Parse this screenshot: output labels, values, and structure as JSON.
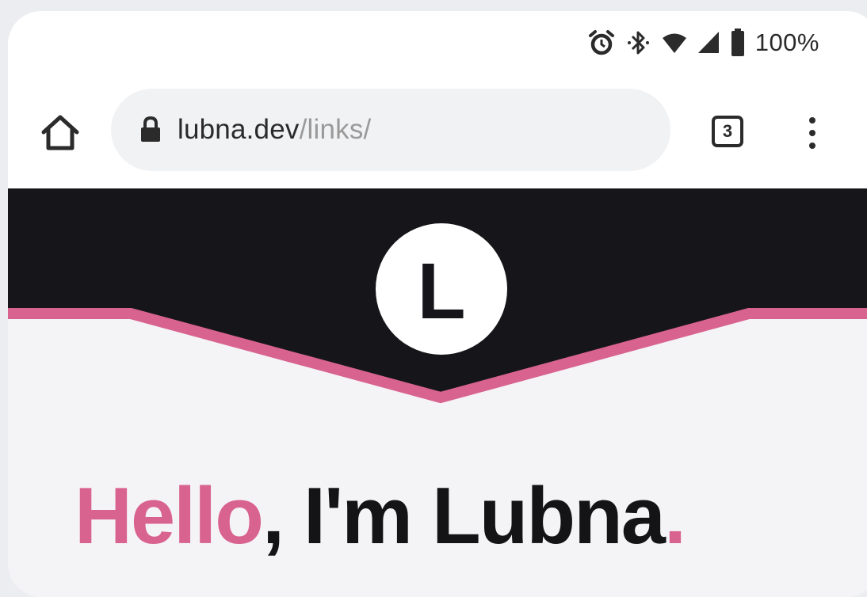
{
  "status_bar": {
    "battery": "100%",
    "icons": [
      "alarm-icon",
      "bluetooth-icon",
      "wifi-icon",
      "signal-icon",
      "battery-icon"
    ]
  },
  "browser": {
    "url_host": "lubna.dev",
    "url_path": "/links/",
    "tab_count": "3",
    "icons": [
      "home-icon",
      "lock-icon",
      "more-vert-icon"
    ]
  },
  "page": {
    "logo_letter": "L",
    "greeting": {
      "hello": "Hello",
      "comma": ",",
      "rest": " I'm Lubna",
      "period": "."
    }
  },
  "colors": {
    "accent": "#d9638f",
    "dark": "#16161a",
    "background": "#f4f4f6"
  }
}
